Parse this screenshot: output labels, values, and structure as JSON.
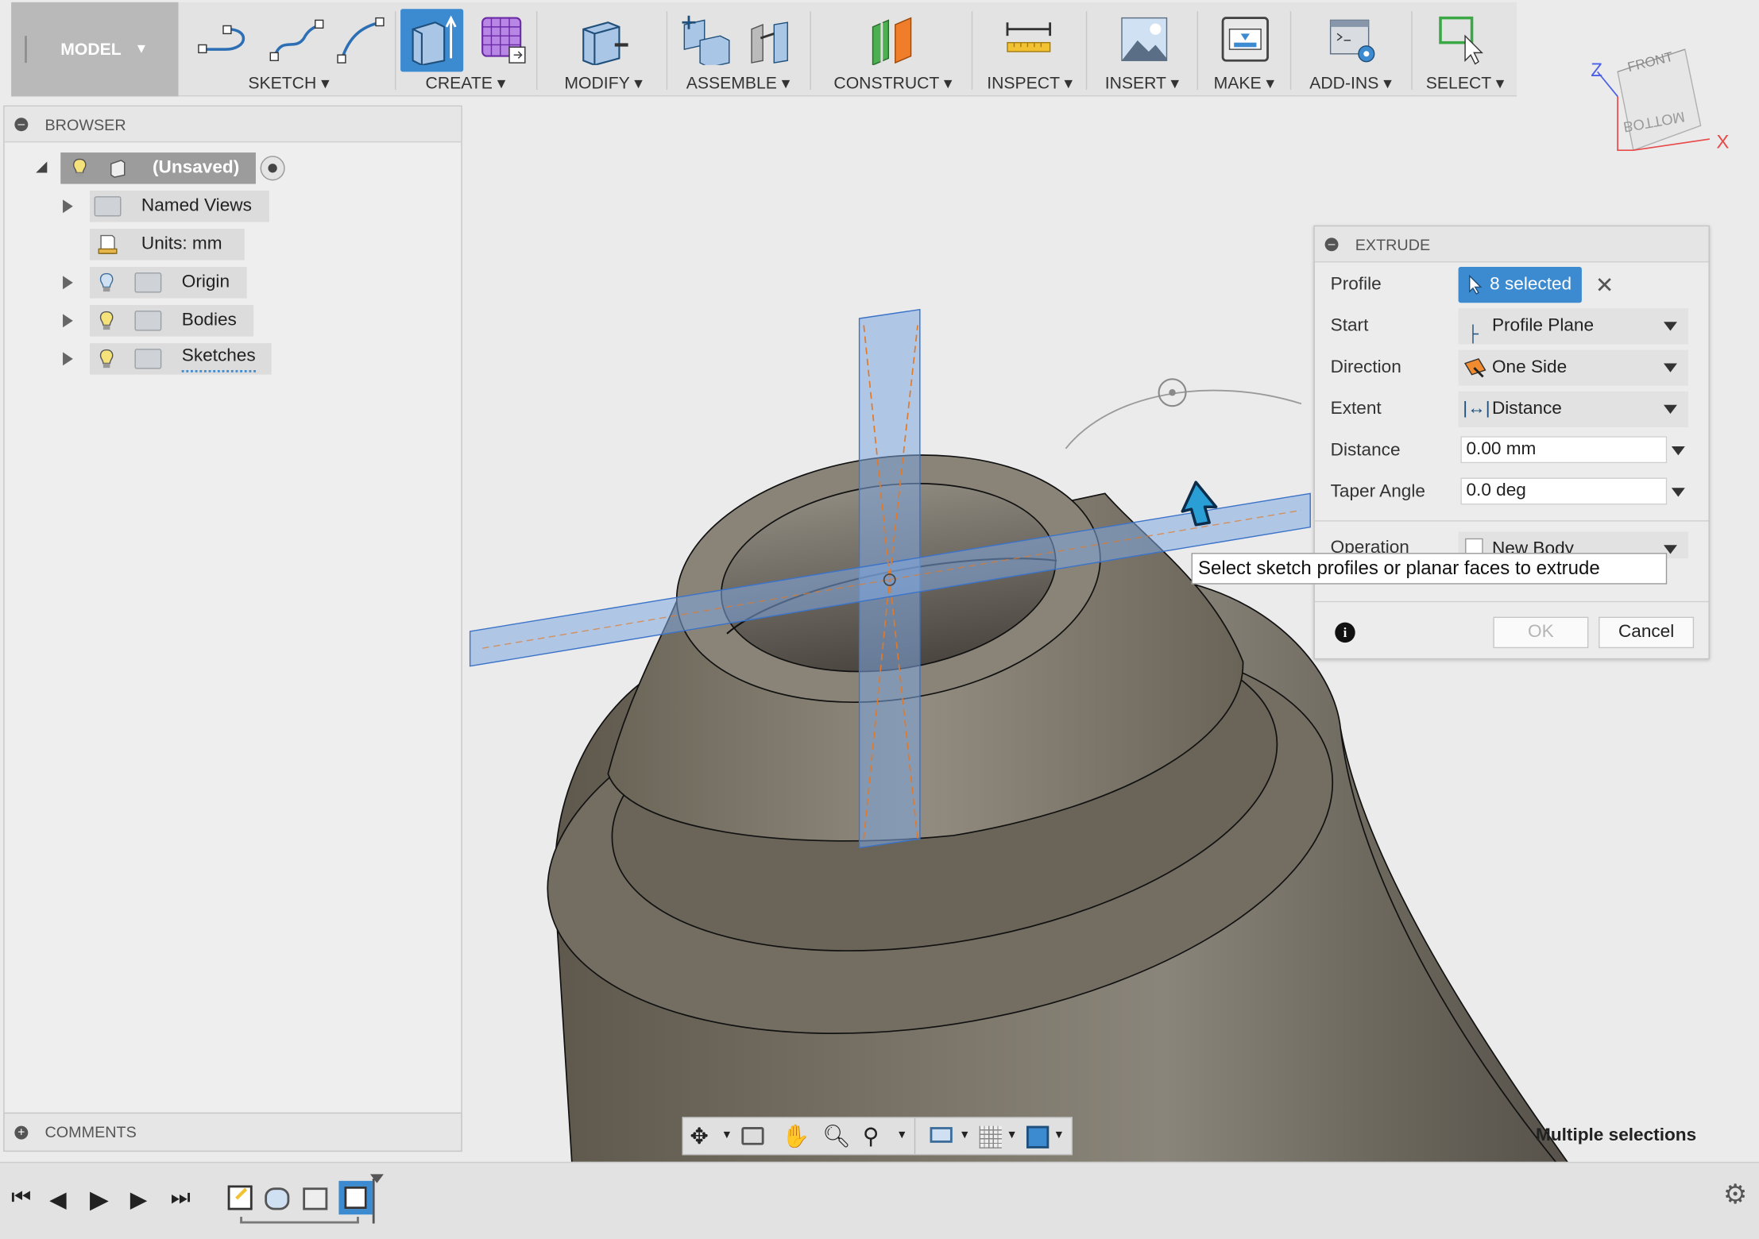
{
  "toolbar": {
    "workspace": "MODEL",
    "groups": [
      {
        "label": "SKETCH"
      },
      {
        "label": "CREATE"
      },
      {
        "label": "MODIFY"
      },
      {
        "label": "ASSEMBLE"
      },
      {
        "label": "CONSTRUCT"
      },
      {
        "label": "INSPECT"
      },
      {
        "label": "INSERT"
      },
      {
        "label": "MAKE"
      },
      {
        "label": "ADD-INS"
      },
      {
        "label": "SELECT"
      }
    ]
  },
  "viewcube": {
    "front": "FRONT",
    "bottom": "BOTTOM",
    "axis_x": "X",
    "axis_z": "Z"
  },
  "browser": {
    "title": "BROWSER",
    "root": "(Unsaved)",
    "items": [
      {
        "label": "Named Views"
      },
      {
        "label": "Units: mm"
      },
      {
        "label": "Origin"
      },
      {
        "label": "Bodies"
      },
      {
        "label": "Sketches"
      }
    ]
  },
  "comments": {
    "title": "COMMENTS"
  },
  "extrude": {
    "title": "EXTRUDE",
    "profile_label": "Profile",
    "profile_value": "8 selected",
    "start_label": "Start",
    "start_value": "Profile Plane",
    "direction_label": "Direction",
    "direction_value": "One Side",
    "extent_label": "Extent",
    "extent_value": "Distance",
    "distance_label": "Distance",
    "distance_value": "0.00 mm",
    "taper_label": "Taper Angle",
    "taper_value": "0.0 deg",
    "operation_label": "Operation",
    "operation_value": "New Body",
    "ok": "OK",
    "cancel": "Cancel"
  },
  "tooltip": "Select sketch profiles or planar faces to extrude",
  "status": "Multiple selections",
  "colors": {
    "accent": "#3c8ad0",
    "body": "#6f695e",
    "plane": "#7fa7e0"
  }
}
